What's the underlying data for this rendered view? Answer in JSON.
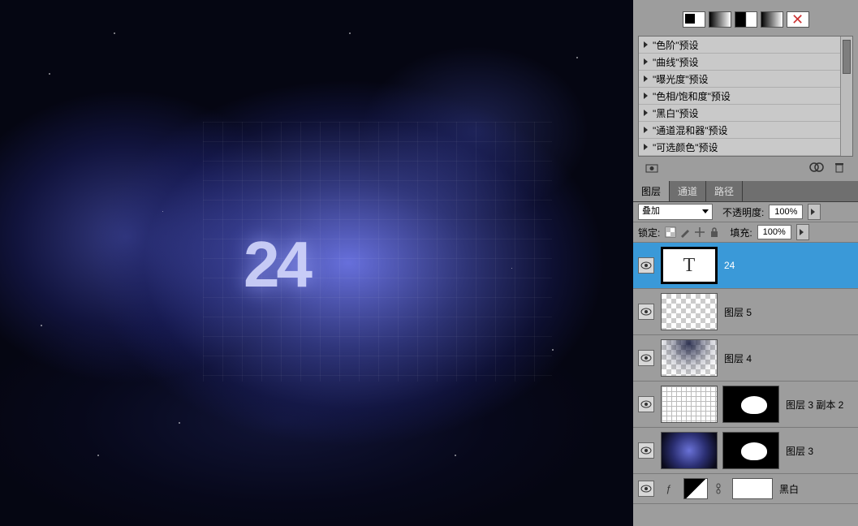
{
  "canvas_text": "24",
  "presets": {
    "items": [
      "\"色阶\"预设",
      "\"曲线\"预设",
      "\"曝光度\"预设",
      "\"色相/饱和度\"预设",
      "\"黑白\"预设",
      "\"通道混和器\"预设",
      "\"可选颜色\"预设"
    ]
  },
  "tabs": {
    "layers": "图层",
    "channels": "通道",
    "paths": "路径"
  },
  "blend": {
    "mode_label": "叠加",
    "opacity_label": "不透明度:",
    "opacity_value": "100%",
    "lock_label": "锁定:",
    "fill_label": "填充:",
    "fill_value": "100%"
  },
  "layers": [
    {
      "name": "24",
      "type": "text",
      "selected": true
    },
    {
      "name": "图层 5",
      "type": "checker"
    },
    {
      "name": "图层 4",
      "type": "checker_dark"
    },
    {
      "name": "图层 3 副本 2",
      "type": "grid_mask"
    },
    {
      "name": "图层 3",
      "type": "neb_mask"
    },
    {
      "name": "黑白",
      "type": "adjustment"
    }
  ]
}
